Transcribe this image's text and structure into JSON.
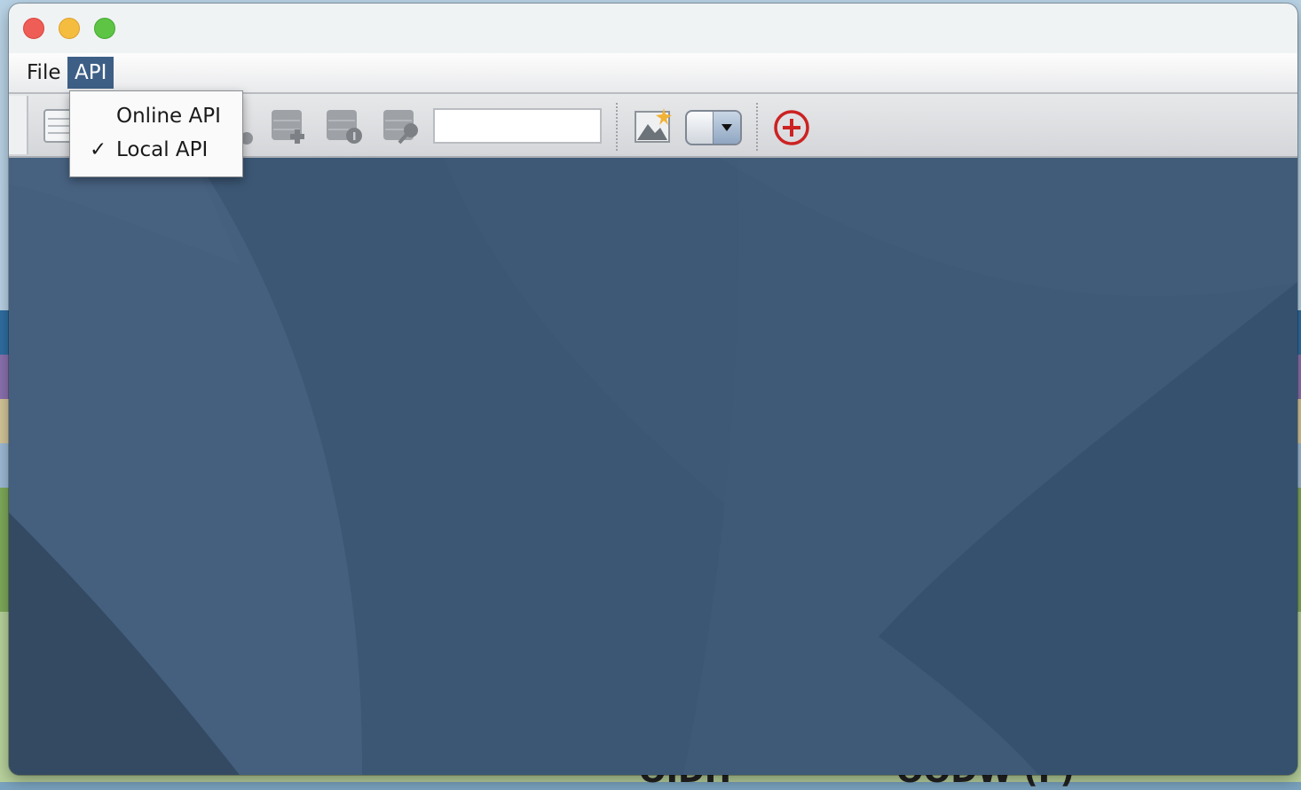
{
  "menubar": {
    "items": [
      {
        "label": "File",
        "active": false
      },
      {
        "label": "API",
        "active": true
      }
    ]
  },
  "api_menu": {
    "items": [
      {
        "label": "Online API",
        "checked": false,
        "check_glyph": ""
      },
      {
        "label": "Local API",
        "checked": true,
        "check_glyph": "✓"
      }
    ]
  },
  "toolbar": {
    "search_value": "",
    "combo_value": ""
  },
  "background_fragments": {
    "left": "OIDH",
    "right": "OODW (F)"
  },
  "colors": {
    "menu_active": "#3d5f86",
    "add_icon": "#cc2222",
    "content_bg": "#3f5a77"
  }
}
